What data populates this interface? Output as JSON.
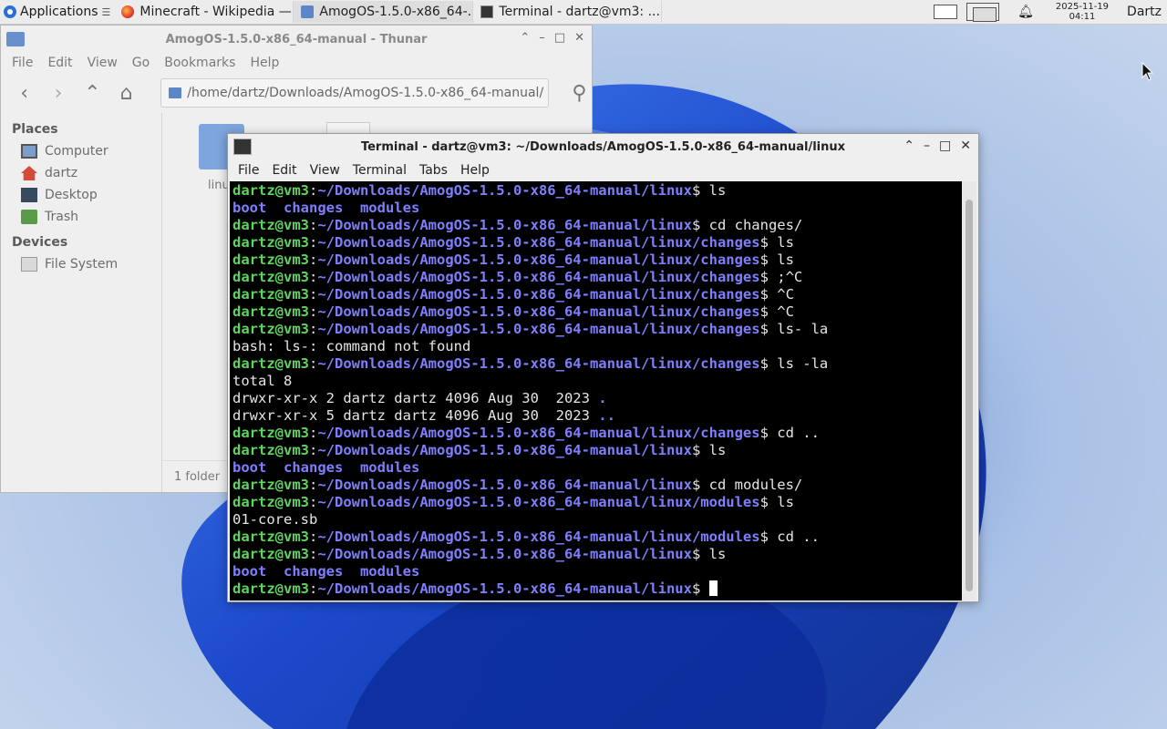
{
  "panel": {
    "apps_label": "Applications",
    "tasks": [
      {
        "label": "Minecraft - Wikipedia —..."
      },
      {
        "label": "AmogOS-1.5.0-x86_64-..."
      },
      {
        "label": "Terminal - dartz@vm3: ..."
      }
    ],
    "clock_date": "2025-11-19",
    "clock_time": "04:11",
    "user": "Dartz"
  },
  "thunar": {
    "title": "AmogOS-1.5.0-x86_64-manual - Thunar",
    "menu": [
      "File",
      "Edit",
      "View",
      "Go",
      "Bookmarks",
      "Help"
    ],
    "path": "/home/dartz/Downloads/AmogOS-1.5.0-x86_64-manual/",
    "places_header": "Places",
    "places": [
      "Computer",
      "dartz",
      "Desktop",
      "Trash"
    ],
    "devices_header": "Devices",
    "devices": [
      "File System"
    ],
    "file_label": "linu",
    "status": "1 folder"
  },
  "terminal": {
    "title": "Terminal - dartz@vm3: ~/Downloads/AmogOS-1.5.0-x86_64-manual/linux",
    "menu": [
      "File",
      "Edit",
      "View",
      "Terminal",
      "Tabs",
      "Help"
    ],
    "lines": [
      {
        "user": "dartz@vm3",
        "path": "~/Downloads/AmogOS-1.5.0-x86_64-manual/linux",
        "cmd": "$ ls"
      },
      {
        "out": "",
        "dirs": "boot  changes  modules"
      },
      {
        "user": "dartz@vm3",
        "path": "~/Downloads/AmogOS-1.5.0-x86_64-manual/linux",
        "cmd": "$ cd changes/"
      },
      {
        "user": "dartz@vm3",
        "path": "~/Downloads/AmogOS-1.5.0-x86_64-manual/linux/changes",
        "cmd": "$ ls"
      },
      {
        "user": "dartz@vm3",
        "path": "~/Downloads/AmogOS-1.5.0-x86_64-manual/linux/changes",
        "cmd": "$ ls"
      },
      {
        "user": "dartz@vm3",
        "path": "~/Downloads/AmogOS-1.5.0-x86_64-manual/linux/changes",
        "cmd": "$ ;^C"
      },
      {
        "user": "dartz@vm3",
        "path": "~/Downloads/AmogOS-1.5.0-x86_64-manual/linux/changes",
        "cmd": "$ ^C"
      },
      {
        "user": "dartz@vm3",
        "path": "~/Downloads/AmogOS-1.5.0-x86_64-manual/linux/changes",
        "cmd": "$ ^C"
      },
      {
        "user": "dartz@vm3",
        "path": "~/Downloads/AmogOS-1.5.0-x86_64-manual/linux/changes",
        "cmd": "$ ls- la"
      },
      {
        "out": "bash: ls-: command not found"
      },
      {
        "user": "dartz@vm3",
        "path": "~/Downloads/AmogOS-1.5.0-x86_64-manual/linux/changes",
        "cmd": "$ ls -la"
      },
      {
        "out": "total 8"
      },
      {
        "out": "drwxr-xr-x 2 dartz dartz 4096 Aug 30  2023 ",
        "dirs": "."
      },
      {
        "out": "drwxr-xr-x 5 dartz dartz 4096 Aug 30  2023 ",
        "dirs": ".."
      },
      {
        "user": "dartz@vm3",
        "path": "~/Downloads/AmogOS-1.5.0-x86_64-manual/linux/changes",
        "cmd": "$ cd .."
      },
      {
        "user": "dartz@vm3",
        "path": "~/Downloads/AmogOS-1.5.0-x86_64-manual/linux",
        "cmd": "$ ls"
      },
      {
        "out": "",
        "dirs": "boot  changes  modules"
      },
      {
        "user": "dartz@vm3",
        "path": "~/Downloads/AmogOS-1.5.0-x86_64-manual/linux",
        "cmd": "$ cd modules/"
      },
      {
        "user": "dartz@vm3",
        "path": "~/Downloads/AmogOS-1.5.0-x86_64-manual/linux/modules",
        "cmd": "$ ls"
      },
      {
        "out": "01-core.sb"
      },
      {
        "user": "dartz@vm3",
        "path": "~/Downloads/AmogOS-1.5.0-x86_64-manual/linux/modules",
        "cmd": "$ cd .."
      },
      {
        "user": "dartz@vm3",
        "path": "~/Downloads/AmogOS-1.5.0-x86_64-manual/linux",
        "cmd": "$ ls"
      },
      {
        "out": "",
        "dirs": "boot  changes  modules"
      },
      {
        "user": "dartz@vm3",
        "path": "~/Downloads/AmogOS-1.5.0-x86_64-manual/linux",
        "cmd": "$ ",
        "cursor": true
      }
    ]
  }
}
